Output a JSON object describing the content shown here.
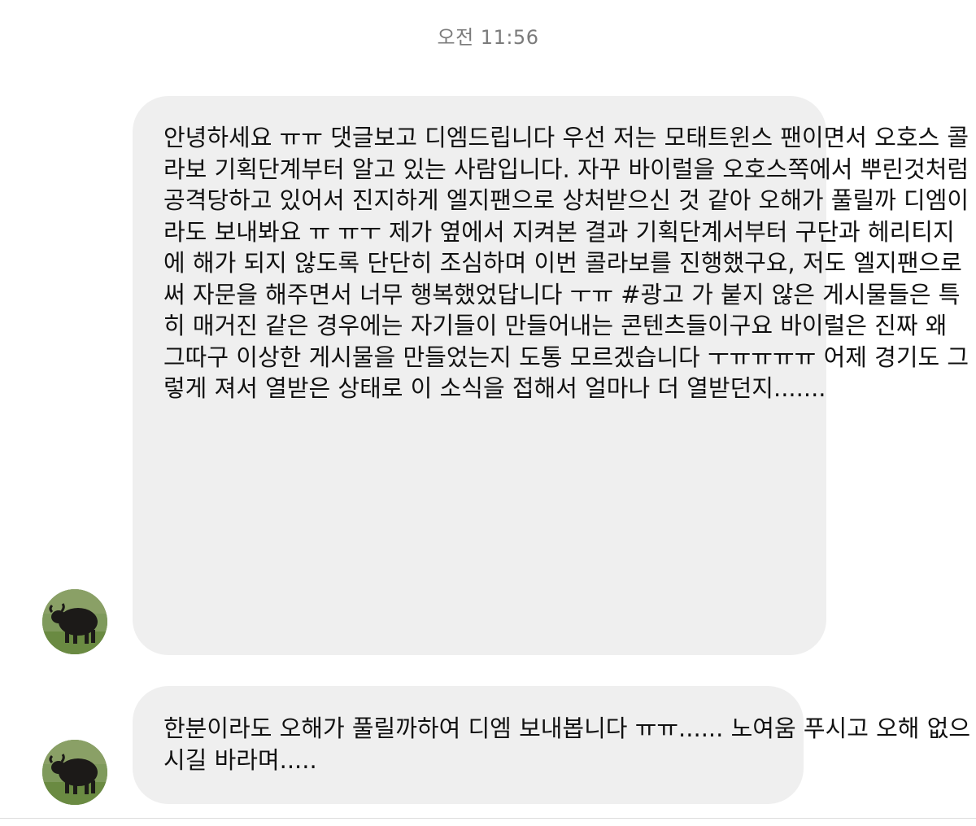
{
  "timestamp": "오전 11:56",
  "messages": [
    {
      "lines": [
        "안녕하세요 ㅠㅠ 댓글보고 디엠드립니다",
        "우선 저는 모태트윈스 팬이면서 오호스 콜라보 기획단계부터",
        "알고 있는 사람입니다. 자꾸 바이럴을 오호스쪽에서",
        "뿌린것처럼 공격당하고 있어서 진지하게 엘지팬으로",
        "상처받으신 것 같아 오해가 풀릴까 디엠이라도 보내봐요 ㅠ",
        "ㅠㅜ 제가 옆에서 지켜본 결과 기획단계서부터 구단과",
        "헤리티지에 해가 되지 않도록 단단히 조심하며 이번",
        "콜라보를 진행했구요,",
        "저도 엘지팬으로써 자문을 해주면서 너무 행복했었답니다",
        "ㅜㅠ #광고 가 붙지 않은 게시물들은 특히 매거진 같은",
        "경우에는 자기들이 만들어내는 콘텐츠들이구요 바이럴은",
        "진짜 왜 그따구 이상한 게시물을 만들었는지 도통",
        "모르겠습니다 ㅜㅠㅠㅠㅠ 어제 경기도 그렇게 져서 열받은",
        "상태로 이 소식을 접해서 얼마나 더 열받던지......."
      ]
    },
    {
      "lines": [
        "한분이라도 오해가 풀릴까하여 디엠 보내봅니다 ㅠㅠ......",
        "노여움 푸시고 오해 없으시길 바라며....."
      ]
    }
  ],
  "avatar_icon": "yak-photo-avatar"
}
